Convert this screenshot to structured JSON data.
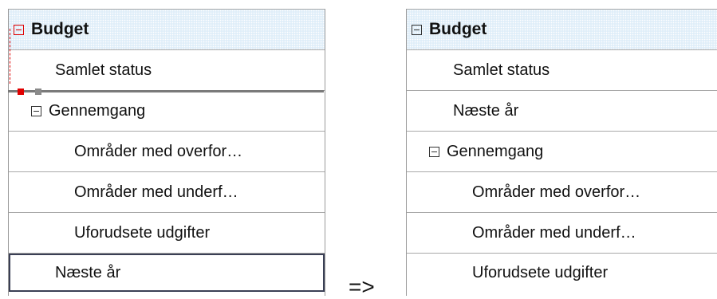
{
  "before": {
    "rows": [
      {
        "label": "Budget",
        "toggle": "minus-box-icon"
      },
      {
        "label": "Samlet status"
      },
      {
        "label": "Gennemgang",
        "toggle": "minus-box-icon"
      },
      {
        "label": "Områder med overfor…"
      },
      {
        "label": "Områder med underf…"
      },
      {
        "label": "Uforudsete udgifter"
      },
      {
        "label": "Næste år"
      }
    ]
  },
  "arrow": "=>",
  "after": {
    "rows": [
      {
        "label": "Budget",
        "toggle": "minus-box-icon"
      },
      {
        "label": "Samlet status"
      },
      {
        "label": "Næste år"
      },
      {
        "label": "Gennemgang",
        "toggle": "minus-box-icon"
      },
      {
        "label": "Områder med overfor…"
      },
      {
        "label": "Områder med underf…"
      },
      {
        "label": "Uforudsete udgifter"
      }
    ]
  },
  "colors": {
    "header_bg": "#dfeef9",
    "drag_indicator": "#e00000",
    "drop_line": "#7a7a7a",
    "selection_border": "#3a3f55"
  }
}
